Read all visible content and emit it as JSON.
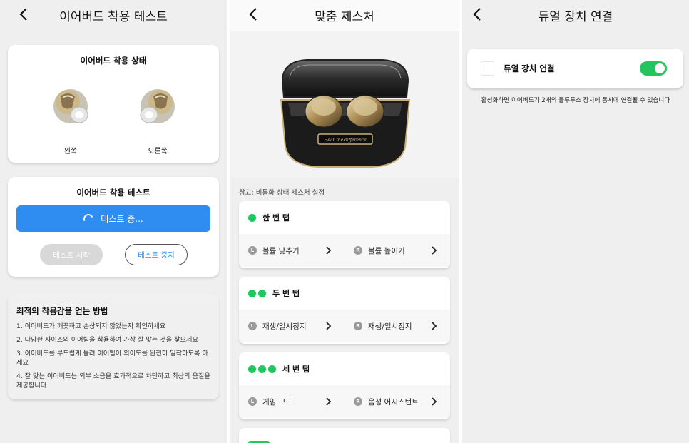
{
  "screen1": {
    "title": "이어버드 착용 테스트",
    "status_card": {
      "title": "이어버드 착용 상태",
      "left_label": "왼쪽",
      "right_label": "오른쪽"
    },
    "test_card": {
      "title": "이어버드 착용 테스트",
      "testing_label": "테스트 중...",
      "start_label": "테스트 시작",
      "stop_label": "테스트 중지"
    },
    "tips": {
      "title": "최적의 착용감을 얻는 방법",
      "items": [
        "1. 이어버드가 깨끗하고 손상되지 않았는지 확인하세요",
        "2. 다양한 사이즈의 이어팁을 착용하여 가장 잘 맞는 것을 찾으세요",
        "3. 이어버드를 부드럽게 돌려 이어팁이 외이도를 완전히 밀착하도록 하세요",
        "4. 잘 맞는 이어버드는 외부 소음을 효과적으로 차단하고 최상의 음질을 제공합니다"
      ]
    }
  },
  "screen2": {
    "title": "맞춤 제스처",
    "case_engraving": "Hear the difference",
    "note": "참고: 비통화 상태 제스처 설정",
    "gestures": [
      {
        "label": "한 번 탭",
        "left_action": "볼륨 낮추기",
        "right_action": "볼륨 높이기"
      },
      {
        "label": "두 번 탭",
        "left_action": "재생/일시정지",
        "right_action": "재생/일시정지"
      },
      {
        "label": "세 번 탭",
        "left_action": "게임 모드",
        "right_action": "음성 어시스턴트"
      }
    ],
    "left_badge": "L",
    "right_badge": "R"
  },
  "screen3": {
    "title": "듀얼 장치 연결",
    "dual_label": "듀얼 장치 연결",
    "dual_enabled": true,
    "description": "활성화하면 이어버드가 2개의 블루투스 장치에 동시에 연결될 수 있습니다"
  },
  "colors": {
    "accent_blue": "#2f8df2",
    "toggle_green": "#22c55e",
    "background": "#efefef"
  }
}
